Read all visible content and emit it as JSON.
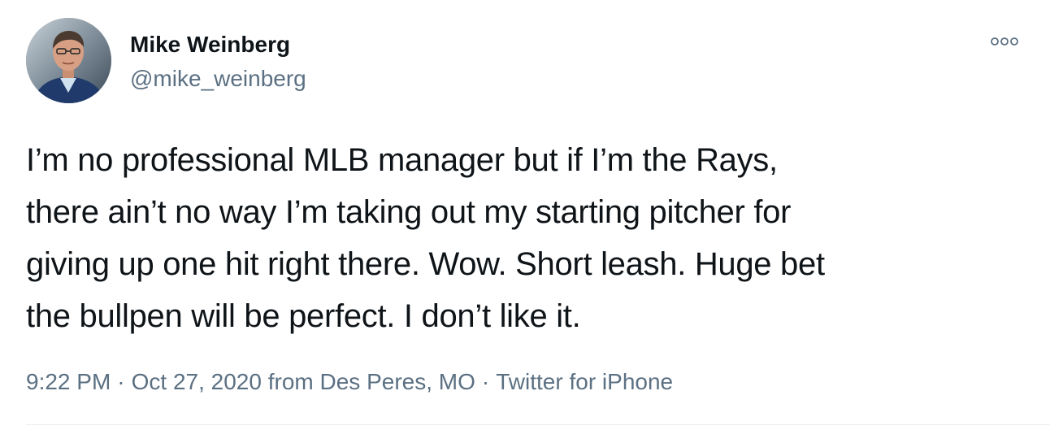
{
  "tweet": {
    "author": {
      "display_name": "Mike Weinberg",
      "handle": "@mike_weinberg"
    },
    "text": "I’m no professional MLB manager but if I’m the Rays,\nthere ain’t no way I’m taking out my starting pitcher for\ngiving up one hit right there. Wow. Short leash. Huge bet\nthe bullpen will be perfect. I don’t like it.",
    "meta": {
      "time": "9:22 PM",
      "date": "Oct 27, 2020",
      "location": "from Des Peres, MO",
      "source": "Twitter for iPhone",
      "separator": "·"
    },
    "icons": {
      "more": "more-options-icon"
    },
    "colors": {
      "text": "#0f1419",
      "secondary": "#5b7083",
      "divider": "#ebeef0"
    }
  }
}
